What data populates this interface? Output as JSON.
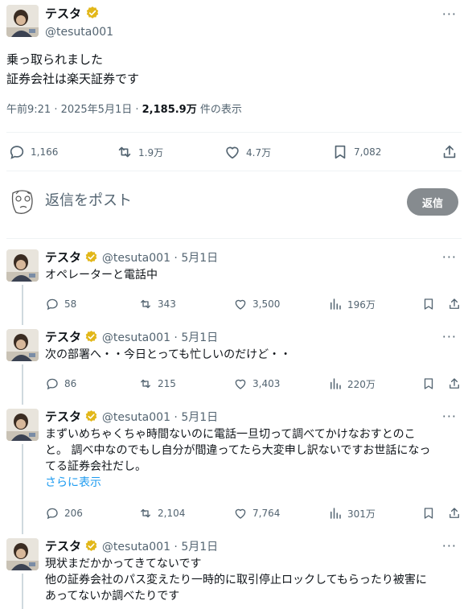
{
  "main": {
    "name": "テスタ",
    "handle": "@tesuta001",
    "text_lines": [
      "乗っ取られました",
      "証券会社は楽天証券です"
    ],
    "meta_time": "午前9:21 · 2025年5月1日 · ",
    "views_count": "2,185.9万",
    "views_label": " 件の表示",
    "actions": {
      "replies": "1,166",
      "retweets": "1.9万",
      "likes": "4.7万",
      "bookmarks": "7,082"
    }
  },
  "reply": {
    "placeholder": "返信をポスト",
    "button": "返信"
  },
  "thread": [
    {
      "name": "テスタ",
      "meta": "@tesuta001 · 5月1日",
      "lines": [
        "オペレーターと電話中"
      ],
      "show_more": "",
      "actions": {
        "replies": "58",
        "retweets": "343",
        "likes": "3,500",
        "views": "196万"
      }
    },
    {
      "name": "テスタ",
      "meta": "@tesuta001 · 5月1日",
      "lines": [
        "次の部署へ・・今日とっても忙しいのだけど・・"
      ],
      "show_more": "",
      "actions": {
        "replies": "86",
        "retweets": "215",
        "likes": "3,403",
        "views": "220万"
      }
    },
    {
      "name": "テスタ",
      "meta": "@tesuta001 · 5月1日",
      "lines": [
        "まずいめちゃくちゃ時間ないのに電話一旦切って調べてかけなおすとのこ",
        "と。 調べ中なのでもし自分が間違ってたら大変申し訳ないですお世話になっ",
        "てる証券会社だし。"
      ],
      "show_more": "さらに表示",
      "actions": {
        "replies": "206",
        "retweets": "2,104",
        "likes": "7,764",
        "views": "301万"
      }
    },
    {
      "name": "テスタ",
      "meta": "@tesuta001 · 5月1日",
      "lines": [
        "現状まだかかってきてないです",
        "他の証券会社のパス変えたり一時的に取引停止ロックしてもらったり被害に",
        "あってないか調べたりです"
      ],
      "show_more": "",
      "actions": {
        "replies": "",
        "retweets": "",
        "likes": "",
        "views": ""
      }
    }
  ],
  "colors": {
    "accent": "#1d9bf0",
    "muted": "#536471",
    "verified": "#e2b719",
    "reply_button": "#868b8f"
  }
}
